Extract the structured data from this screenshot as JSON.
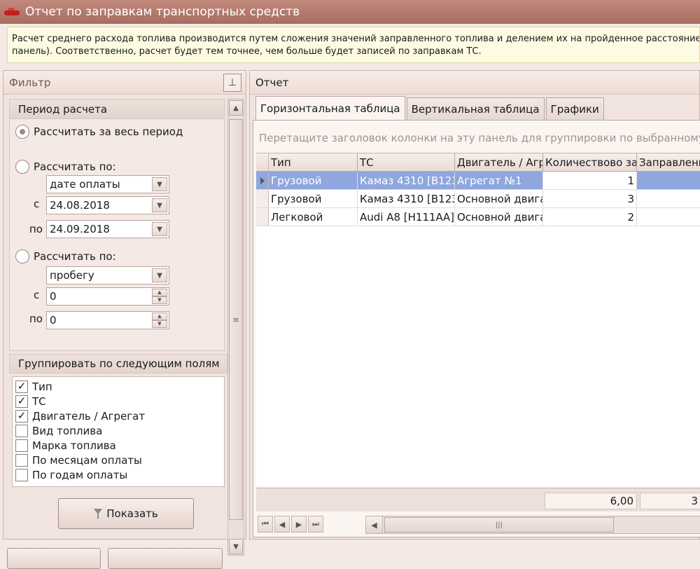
{
  "window": {
    "title": "Отчет по заправкам транспортных средств"
  },
  "info_text": {
    "line1": "Расчет среднего расхода топлива производится путем сложения значений заправленного топлива и делением их на пройденное расстояние ТС (согл",
    "line2": "панель). Соответственно, расчет будет тем точнее, чем больше будет записей по заправкам ТС."
  },
  "filter": {
    "title": "Фильтр",
    "period": {
      "title": "Период расчета",
      "option_all": "Рассчитать за весь период",
      "option_by_1": "Рассчитать по:",
      "by_1_value": "дате оплаты",
      "from_label": "с",
      "to_label": "по",
      "date_from": "24.08.2018",
      "date_to": "24.09.2018",
      "option_by_2": "Рассчитать по:",
      "by_2_value": "пробегу",
      "num_from_label": "с",
      "num_to_label": "по",
      "num_from": "0",
      "num_to": "0",
      "selected": "all"
    },
    "grouping": {
      "title": "Группировать по следующим полям",
      "items": [
        {
          "label": "Тип",
          "checked": true
        },
        {
          "label": "ТС",
          "checked": true
        },
        {
          "label": "Двигатель / Агрегат",
          "checked": true
        },
        {
          "label": "Вид топлива",
          "checked": false
        },
        {
          "label": "Марка топлива",
          "checked": false
        },
        {
          "label": "По месяцам оплаты",
          "checked": false
        },
        {
          "label": "По годам оплаты",
          "checked": false
        }
      ]
    },
    "show_button": "Показать"
  },
  "report": {
    "title": "Отчет",
    "tabs": [
      "Горизонтальная таблица",
      "Вертикальная таблица",
      "Графики"
    ],
    "active_tab": 0,
    "group_hint": "Перетащите заголовок колонки на эту панель для группировки по выбранному п",
    "columns": [
      "Тип",
      "ТС",
      "Двигатель / Агр",
      "Количествово за",
      "Заправленн"
    ],
    "rows": [
      {
        "type": "Грузовой",
        "vehicle": "Камаз 4310 [В123",
        "engine": "Агрегат №1",
        "count": "1",
        "fuel": ""
      },
      {
        "type": "Грузовой",
        "vehicle": "Камаз 4310 [В123",
        "engine": "Основной двига",
        "count": "3",
        "fuel": ""
      },
      {
        "type": "Легковой",
        "vehicle": "Audi A8 [Н111АА]",
        "engine": "Основной двига",
        "count": "2",
        "fuel": ""
      }
    ],
    "selected_row": 0,
    "totals": {
      "count": "6,00",
      "fuel": "3"
    }
  }
}
